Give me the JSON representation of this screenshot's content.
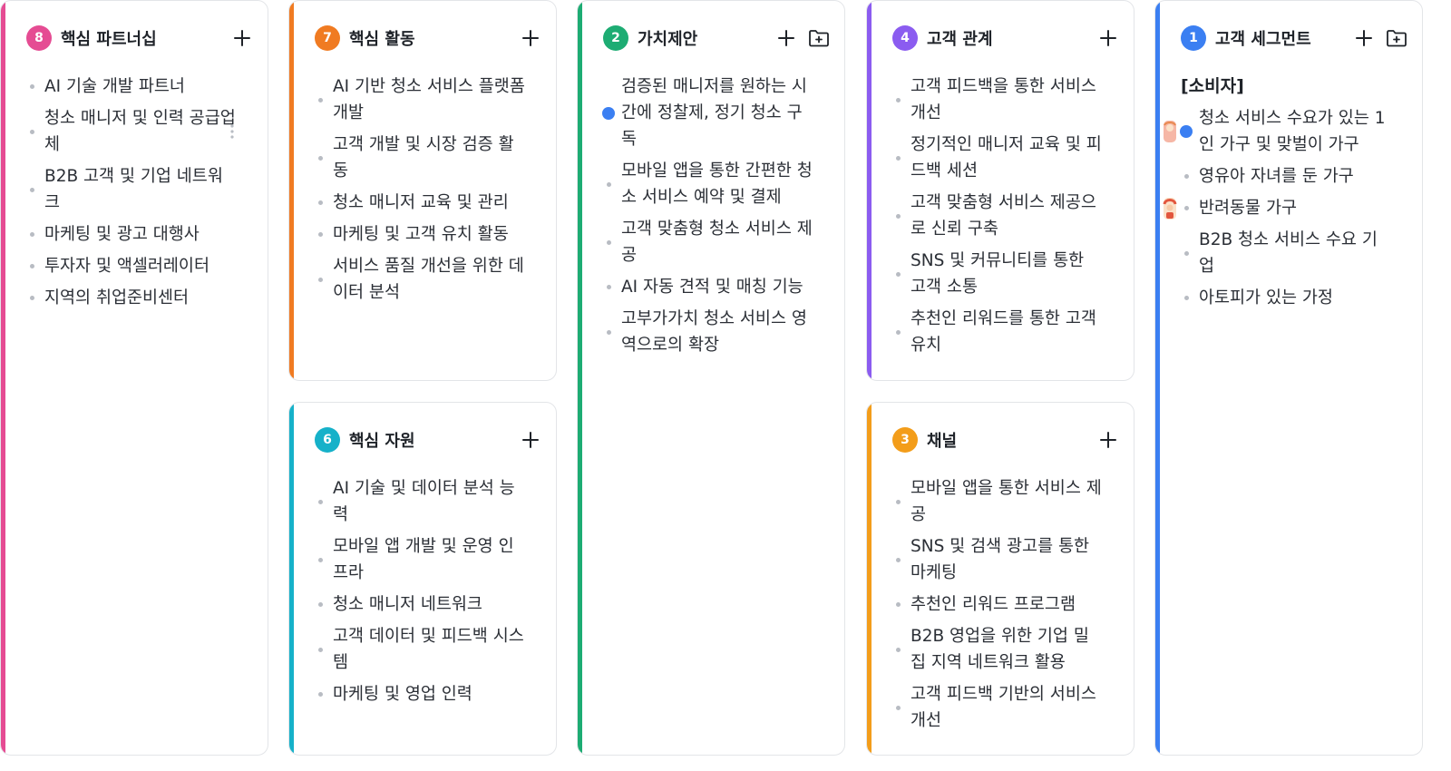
{
  "colors": {
    "partners": "#e54c93",
    "activities": "#f07b22",
    "resources": "#16b1c9",
    "value": "#1dac73",
    "relations": "#8b5cf0",
    "channels": "#f39d1a",
    "segments": "#3b7ff2"
  },
  "cards": {
    "partners": {
      "number": "8",
      "title": "핵심 파트너십",
      "items": [
        "AI 기술 개발 파트너",
        "청소 매니저 및 인력 공급업체",
        "B2B 고객 및 기업 네트워크",
        "마케팅 및 광고 대행사",
        "투자자 및 액셀러레이터",
        "지역의 취업준비센터"
      ]
    },
    "activities": {
      "number": "7",
      "title": "핵심 활동",
      "items": [
        "AI 기반 청소 서비스 플랫폼 개발",
        "고객 개발 및 시장 검증 활동",
        "청소 매니저 교육 및 관리",
        "마케팅 및 고객 유치 활동",
        "서비스 품질 개선을 위한 데이터 분석"
      ]
    },
    "resources": {
      "number": "6",
      "title": "핵심 자원",
      "items": [
        "AI 기술 및 데이터 분석 능력",
        "모바일 앱 개발 및 운영 인프라",
        "청소 매니저 네트워크",
        "고객 데이터 및 피드백 시스템",
        "마케팅 및 영업 인력"
      ]
    },
    "value": {
      "number": "2",
      "title": "가치제안",
      "items": [
        "검증된 매니저를 원하는 시간에 정찰제, 정기 청소 구독",
        "모바일 앱을 통한 간편한 청소 서비스 예약 및 결제",
        "고객 맞춤형 청소 서비스 제공",
        "AI 자동 견적 및 매칭 기능",
        "고부가가치 청소 서비스 영역으로의 확장"
      ]
    },
    "relations": {
      "number": "4",
      "title": "고객 관계",
      "items": [
        "고객 피드백을 통한 서비스 개선",
        "정기적인 매니저 교육 및 피드백 세션",
        "고객 맞춤형 서비스 제공으로 신뢰 구축",
        "SNS 및 커뮤니티를 통한 고객 소통",
        "추천인 리워드를 통한 고객 유치"
      ]
    },
    "channels": {
      "number": "3",
      "title": "채널",
      "items": [
        "모바일 앱을 통한 서비스 제공",
        "SNS 및 검색 광고를 통한 마케팅",
        "추천인 리워드 프로그램",
        "B2B 영업을 위한 기업 밀집 지역 네트워크 활용",
        "고객 피드백 기반의 서비스 개선"
      ]
    },
    "segments": {
      "number": "1",
      "title": "고객 세그먼트",
      "section": "[소비자]",
      "items": [
        "청소 서비스 수요가 있는 1인 가구 및 맞벌이 가구",
        "영유아 자녀를 둔 가구",
        "반려동물 가구",
        "B2B 청소 서비스 수요 기업",
        "아토피가 있는 가정"
      ]
    }
  },
  "icons": {
    "add": "plus-icon",
    "add_folder": "folder-plus-icon",
    "drag": "drag-handle-icon"
  }
}
